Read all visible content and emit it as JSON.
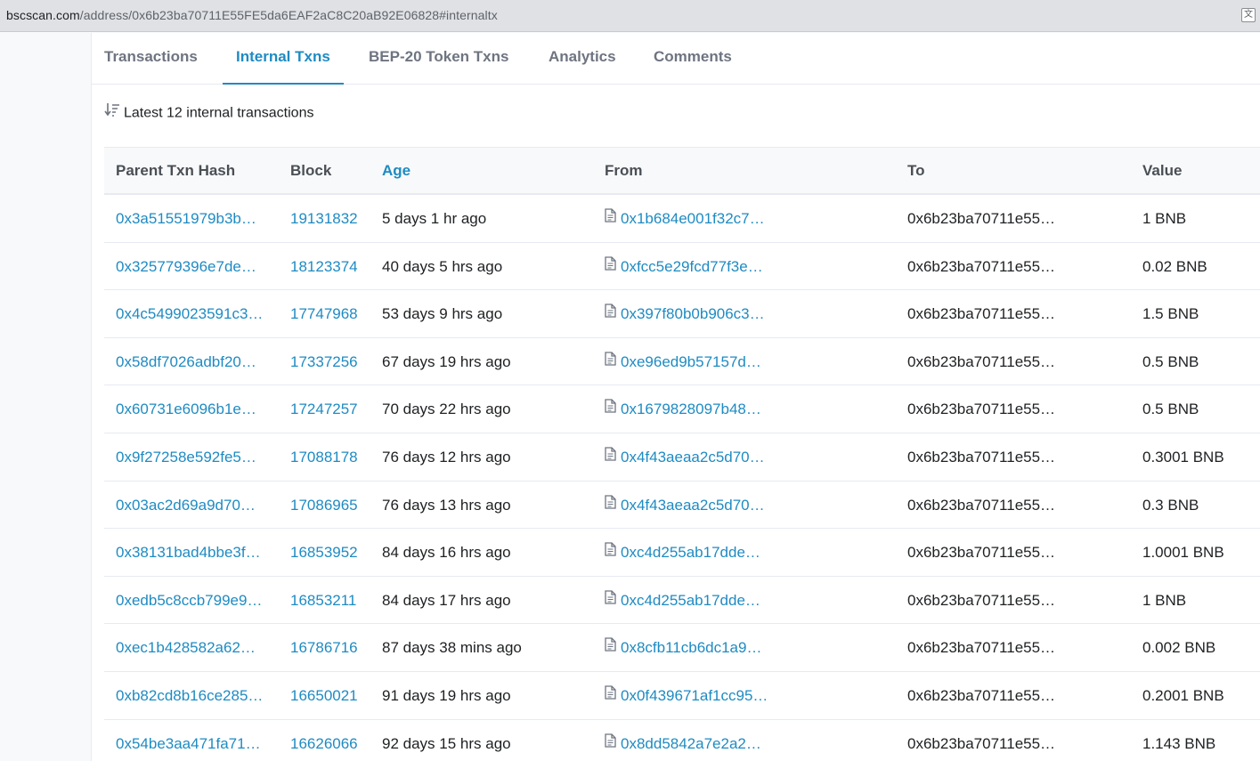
{
  "browser": {
    "url_domain": "bscscan.com",
    "url_path": "/address/0x6b23ba70711E55FE5da6EAF2aC8C20aB92E06828#internaltx"
  },
  "tabs": [
    {
      "label": "Transactions",
      "active": false
    },
    {
      "label": "Internal Txns",
      "active": true
    },
    {
      "label": "BEP-20 Token Txns",
      "active": false
    },
    {
      "label": "Analytics",
      "active": false
    },
    {
      "label": "Comments",
      "active": false
    }
  ],
  "summary": "Latest 12 internal transactions",
  "table": {
    "headers": {
      "hash": "Parent Txn Hash",
      "block": "Block",
      "age": "Age",
      "from": "From",
      "to": "To",
      "value": "Value"
    },
    "rows": [
      {
        "hash": "0x3a51551979b3b…",
        "block": "19131832",
        "age": "5 days 1 hr ago",
        "from": "0x1b684e001f32c7…",
        "to": "0x6b23ba70711e55…",
        "value": "1 BNB"
      },
      {
        "hash": "0x325779396e7de…",
        "block": "18123374",
        "age": "40 days 5 hrs ago",
        "from": "0xfcc5e29fcd77f3e…",
        "to": "0x6b23ba70711e55…",
        "value": "0.02 BNB"
      },
      {
        "hash": "0x4c5499023591c3…",
        "block": "17747968",
        "age": "53 days 9 hrs ago",
        "from": "0x397f80b0b906c3…",
        "to": "0x6b23ba70711e55…",
        "value": "1.5 BNB"
      },
      {
        "hash": "0x58df7026adbf20…",
        "block": "17337256",
        "age": "67 days 19 hrs ago",
        "from": "0xe96ed9b57157d…",
        "to": "0x6b23ba70711e55…",
        "value": "0.5 BNB"
      },
      {
        "hash": "0x60731e6096b1e…",
        "block": "17247257",
        "age": "70 days 22 hrs ago",
        "from": "0x1679828097b48…",
        "to": "0x6b23ba70711e55…",
        "value": "0.5 BNB"
      },
      {
        "hash": "0x9f27258e592fe5…",
        "block": "17088178",
        "age": "76 days 12 hrs ago",
        "from": "0x4f43aeaa2c5d70…",
        "to": "0x6b23ba70711e55…",
        "value": "0.3001 BNB"
      },
      {
        "hash": "0x03ac2d69a9d70…",
        "block": "17086965",
        "age": "76 days 13 hrs ago",
        "from": "0x4f43aeaa2c5d70…",
        "to": "0x6b23ba70711e55…",
        "value": "0.3 BNB"
      },
      {
        "hash": "0x38131bad4bbe3f…",
        "block": "16853952",
        "age": "84 days 16 hrs ago",
        "from": "0xc4d255ab17dde…",
        "to": "0x6b23ba70711e55…",
        "value": "1.0001 BNB"
      },
      {
        "hash": "0xedb5c8ccb799e9…",
        "block": "16853211",
        "age": "84 days 17 hrs ago",
        "from": "0xc4d255ab17dde…",
        "to": "0x6b23ba70711e55…",
        "value": "1 BNB"
      },
      {
        "hash": "0xec1b428582a62…",
        "block": "16786716",
        "age": "87 days 38 mins ago",
        "from": "0x8cfb11cb6dc1a9…",
        "to": "0x6b23ba70711e55…",
        "value": "0.002 BNB"
      },
      {
        "hash": "0xb82cd8b16ce285…",
        "block": "16650021",
        "age": "91 days 19 hrs ago",
        "from": "0x0f439671af1cc95…",
        "to": "0x6b23ba70711e55…",
        "value": "0.2001 BNB"
      },
      {
        "hash": "0x54be3aa471fa71…",
        "block": "16626066",
        "age": "92 days 15 hrs ago",
        "from": "0x8dd5842a7e2a2…",
        "to": "0x6b23ba70711e55…",
        "value": "1.143 BNB"
      }
    ]
  },
  "colors": {
    "accent": "#1e8bc3",
    "in_badge_bg": "#dcf5ee",
    "in_badge_fg": "#00a186"
  },
  "icons": {
    "sort": "sort-descending-icon",
    "contract": "document-icon",
    "direction": "arrow-right-icon",
    "translate": "translate-icon"
  }
}
